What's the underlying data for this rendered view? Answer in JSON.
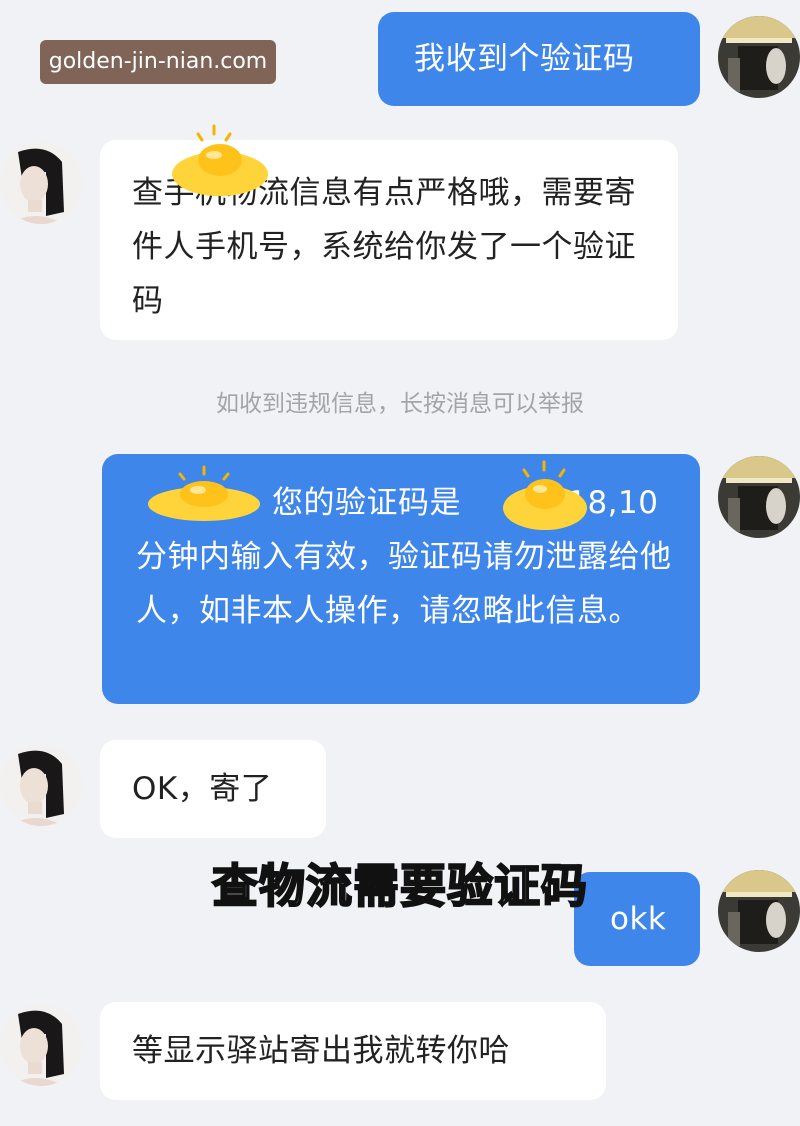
{
  "watermark": "golden-jin-nian.com",
  "messages": [
    {
      "id": "m1",
      "sender": "me",
      "text": "我收到个验证码"
    },
    {
      "id": "m2",
      "sender": "other",
      "text": "查手机物流信息有点严格哦，需要寄件人手机号，系统给你发了一个验证码"
    },
    {
      "id": "m3",
      "sender": "me",
      "text_visible_after_redaction": "您的验证码是",
      "code_visible_part": "518,",
      "text_rest": "10分钟内输入有效，验证码请勿泄露给他人，如非本人操作，请忽略此信息。"
    },
    {
      "id": "m4",
      "sender": "other",
      "text": "OK，寄了"
    },
    {
      "id": "m5",
      "sender": "me",
      "text": "okk"
    },
    {
      "id": "m6",
      "sender": "other",
      "text": "等显示驿站寄出我就转你哈"
    }
  ],
  "system_note": "如收到违规信息，长按消息可以举报",
  "caption": "查物流需要验证码",
  "colors": {
    "my_bubble": "#3f86ea",
    "their_bubble": "#ffffff",
    "background": "#f1f2f5",
    "system_text": "#a2a4a8"
  },
  "icons": [
    "avatar-self",
    "avatar-contact",
    "gold-ingot-sticker"
  ]
}
